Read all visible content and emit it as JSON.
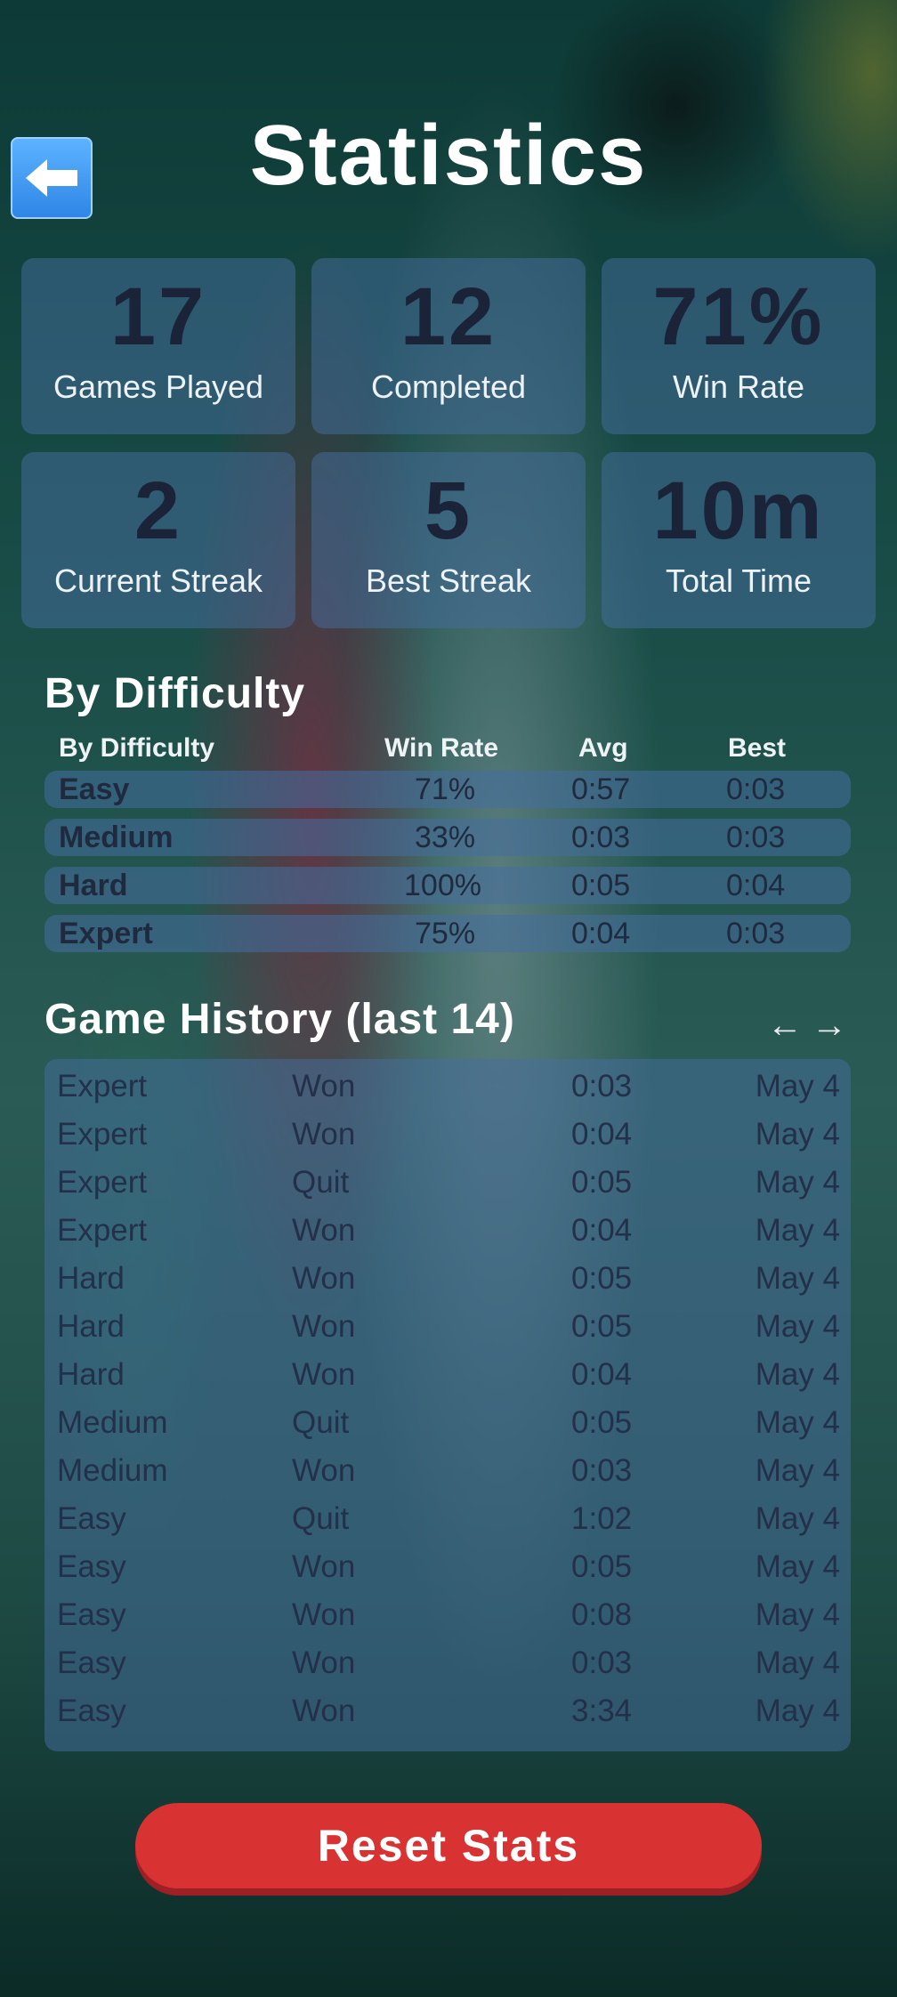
{
  "header": {
    "title": "Statistics",
    "back_icon": "back-arrow-icon"
  },
  "stats": [
    {
      "value": "17",
      "label": "Games Played"
    },
    {
      "value": "12",
      "label": "Completed"
    },
    {
      "value": "71%",
      "label": "Win Rate"
    },
    {
      "value": "2",
      "label": "Current Streak"
    },
    {
      "value": "5",
      "label": "Best Streak"
    },
    {
      "value": "10m",
      "label": "Total Time"
    }
  ],
  "difficulty": {
    "title": "By Difficulty",
    "columns": [
      "By Difficulty",
      "Win Rate",
      "Avg",
      "Best"
    ],
    "rows": [
      {
        "name": "Easy",
        "win_rate": "71%",
        "avg": "0:57",
        "best": "0:03"
      },
      {
        "name": "Medium",
        "win_rate": "33%",
        "avg": "0:03",
        "best": "0:03"
      },
      {
        "name": "Hard",
        "win_rate": "100%",
        "avg": "0:05",
        "best": "0:04"
      },
      {
        "name": "Expert",
        "win_rate": "75%",
        "avg": "0:04",
        "best": "0:03"
      }
    ]
  },
  "history": {
    "title": "Game History (last 14)",
    "prev_label": "←",
    "next_label": "→",
    "rows": [
      {
        "difficulty": "Expert",
        "result": "Won",
        "time": "0:03",
        "date": "May 4"
      },
      {
        "difficulty": "Expert",
        "result": "Won",
        "time": "0:04",
        "date": "May 4"
      },
      {
        "difficulty": "Expert",
        "result": "Quit",
        "time": "0:05",
        "date": "May 4"
      },
      {
        "difficulty": "Expert",
        "result": "Won",
        "time": "0:04",
        "date": "May 4"
      },
      {
        "difficulty": "Hard",
        "result": "Won",
        "time": "0:05",
        "date": "May 4"
      },
      {
        "difficulty": "Hard",
        "result": "Won",
        "time": "0:05",
        "date": "May 4"
      },
      {
        "difficulty": "Hard",
        "result": "Won",
        "time": "0:04",
        "date": "May 4"
      },
      {
        "difficulty": "Medium",
        "result": "Quit",
        "time": "0:05",
        "date": "May 4"
      },
      {
        "difficulty": "Medium",
        "result": "Won",
        "time": "0:03",
        "date": "May 4"
      },
      {
        "difficulty": "Easy",
        "result": "Quit",
        "time": "1:02",
        "date": "May 4"
      },
      {
        "difficulty": "Easy",
        "result": "Won",
        "time": "0:05",
        "date": "May 4"
      },
      {
        "difficulty": "Easy",
        "result": "Won",
        "time": "0:08",
        "date": "May 4"
      },
      {
        "difficulty": "Easy",
        "result": "Won",
        "time": "0:03",
        "date": "May 4"
      },
      {
        "difficulty": "Easy",
        "result": "Won",
        "time": "3:34",
        "date": "May 4"
      }
    ]
  },
  "footer": {
    "reset_label": "Reset Stats"
  }
}
